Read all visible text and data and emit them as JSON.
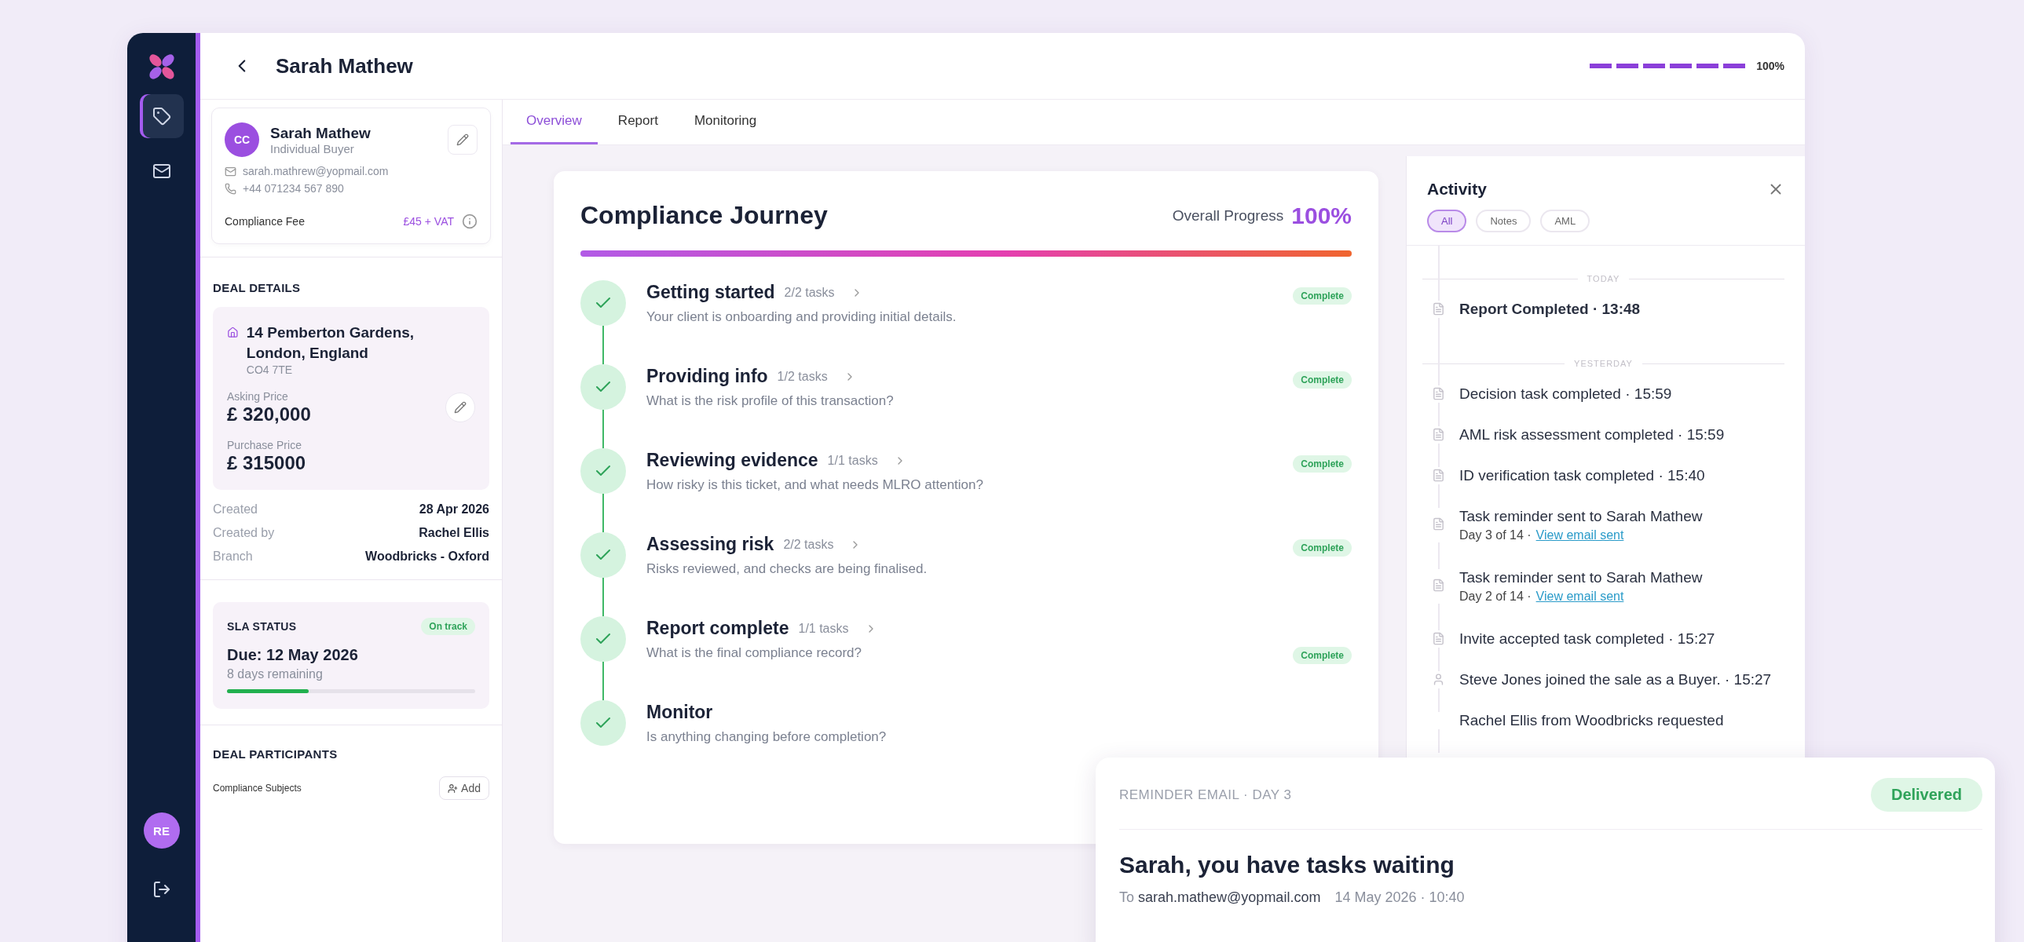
{
  "nav": {
    "items": [
      {
        "selected": true
      },
      {
        "selected": false
      }
    ],
    "user_initials": "RE"
  },
  "header": {
    "title": "Sarah Mathew",
    "progress": {
      "level": 1
    },
    "progress_label": "100%"
  },
  "profile": {
    "initials": "CC",
    "name": "Sarah Mathew",
    "role": "Individual Buyer",
    "email": "sarah.mathrew@yopmail.com",
    "phone": "+44 071234 567 890",
    "fee_label": "Compliance Fee",
    "fee": "£45 + VAT"
  },
  "deal": {
    "heading": "DEAL DETAILS",
    "address": "14 Pemberton Gardens, London, England",
    "postcode": "CO4 7TE",
    "prices": [
      {
        "label": "Asking Price",
        "value": "£ 320,000",
        "editable": true
      },
      {
        "label": "Purchase Price",
        "value": "£ 315000",
        "editable": false
      }
    ],
    "facts": [
      {
        "label": "Created",
        "value": "28 Apr 2026"
      },
      {
        "label": "Created by",
        "value": "Rachel Ellis"
      },
      {
        "label": "Branch",
        "value": "Woodbricks - Oxford"
      }
    ]
  },
  "sla": {
    "heading": "SLA STATUS",
    "badge": "On track",
    "due": "Due: 12 May 2026",
    "remaining": "8 days remaining",
    "level": 0.33
  },
  "participants": {
    "heading": "DEAL PARTICIPANTS",
    "subjects_label": "Compliance Subjects",
    "add_label": "Add"
  },
  "tabs": [
    {
      "label": "Overview",
      "selected": true
    },
    {
      "label": "Report",
      "selected": false
    },
    {
      "label": "Monitoring",
      "selected": false
    }
  ],
  "journey": {
    "title": "Compliance Journey",
    "progress_label": "Overall Progress",
    "progress_value": "100%",
    "level": 1,
    "steps": [
      {
        "title": "Getting started",
        "tasks": "2/2 tasks",
        "description": "Your client is onboarding and providing initial details.",
        "status": "Complete",
        "completed": true
      },
      {
        "title": "Providing info",
        "tasks": "1/2 tasks",
        "description": "What is the risk profile of this transaction?",
        "status": "Complete",
        "completed": true
      },
      {
        "title": "Reviewing evidence",
        "tasks": "1/1 tasks",
        "description": "How risky is this ticket, and what needs MLRO attention?",
        "status": "Complete",
        "completed": true
      },
      {
        "title": "Assessing risk",
        "tasks": "2/2 tasks",
        "description": "Risks reviewed, and checks are being finalised.",
        "status": "Complete",
        "completed": true
      },
      {
        "title": "Report complete",
        "tasks": "1/1 tasks",
        "description": "What is the final compliance record?",
        "status": "Complete",
        "completed": true
      },
      {
        "title": "Monitor",
        "description": "Is anything changing before completion?",
        "completed": true
      }
    ]
  },
  "activity": {
    "title": "Activity",
    "filters": [
      {
        "label": "All",
        "selected": true
      },
      {
        "label": "Notes",
        "selected": false
      },
      {
        "label": "AML",
        "selected": false
      }
    ],
    "entries": [
      {
        "kind": "divider",
        "label": "TODAY"
      },
      {
        "kind": "task",
        "text": "Report Completed · 13:48",
        "emphasis": true
      },
      {
        "kind": "divider",
        "label": "YESTERDAY"
      },
      {
        "kind": "task",
        "text": "Decision task completed · 15:59",
        "emphasis": false
      },
      {
        "kind": "task",
        "text": "AML risk assessment completed · 15:59",
        "emphasis": false
      },
      {
        "kind": "task",
        "text": "ID verification task completed · 15:40",
        "emphasis": false
      },
      {
        "kind": "task",
        "text": "Task reminder sent to Sarah Mathew",
        "detail": "Day 3 of 14 ·",
        "link": "View email sent",
        "emphasis": false
      },
      {
        "kind": "task",
        "text": "Task reminder sent to Sarah Mathew",
        "detail": "Day 2 of 14 ·",
        "link": "View email sent",
        "emphasis": false
      },
      {
        "kind": "task",
        "text": "Invite accepted task completed · 15:27",
        "emphasis": false
      },
      {
        "kind": "participant",
        "text": "Steve Jones joined the sale as a Buyer. · 15:27",
        "emphasis": false
      },
      {
        "kind": "request",
        "text": "Rachel Ellis from Woodbricks requested",
        "emphasis": false
      }
    ]
  },
  "email": {
    "heading": "REMINDER EMAIL · DAY 3",
    "status": "Delivered",
    "subject": "Sarah, you have tasks waiting",
    "to_label": "To",
    "to": "sarah.mathew@yopmail.com",
    "sent": "14 May 2026 · 10:40"
  }
}
